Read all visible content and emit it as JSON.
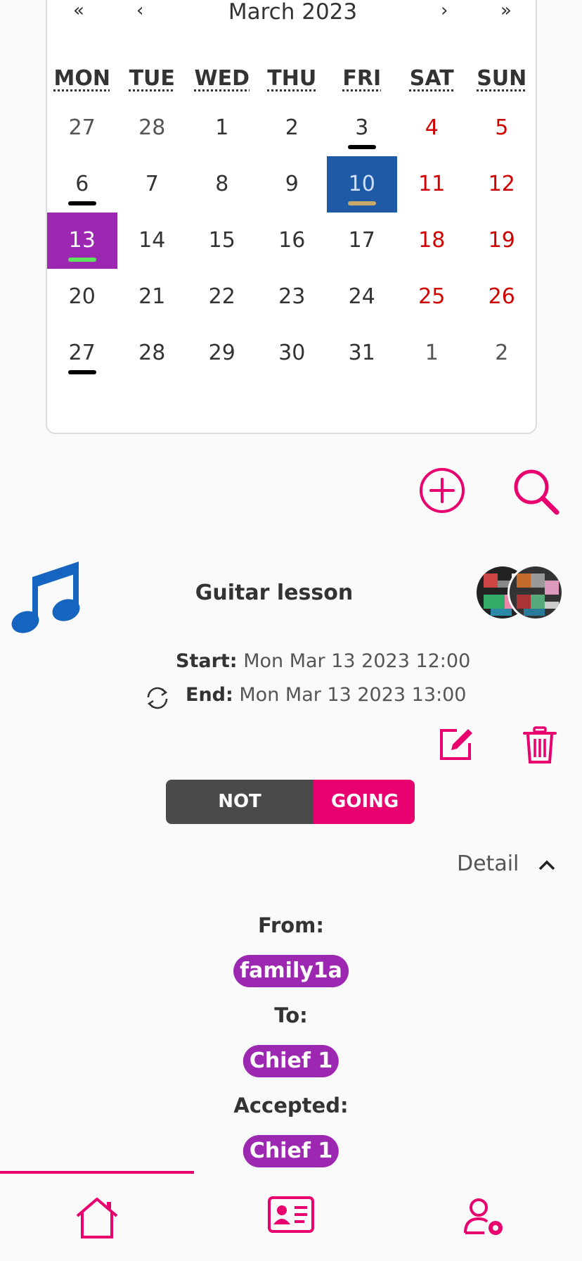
{
  "calendar": {
    "title": "March 2023",
    "nav": {
      "first": "«",
      "prev": "‹",
      "next": "›",
      "last": "»"
    },
    "weekdays": [
      "MON",
      "TUE",
      "WED",
      "THU",
      "FRI",
      "SAT",
      "SUN"
    ],
    "weeks": [
      [
        "27",
        "28",
        "1",
        "2",
        "3",
        "4",
        "5"
      ],
      [
        "6",
        "7",
        "8",
        "9",
        "10",
        "11",
        "12"
      ],
      [
        "13",
        "14",
        "15",
        "16",
        "17",
        "18",
        "19"
      ],
      [
        "20",
        "21",
        "22",
        "23",
        "24",
        "25",
        "26"
      ],
      [
        "27",
        "28",
        "29",
        "30",
        "31",
        "1",
        "2"
      ]
    ],
    "colors": {
      "weekend": "#d10000",
      "today_bg": "#1f5aa6",
      "selected_bg": "#9c27b0",
      "mark_default": "#000000",
      "mark_today": "#c8a96a",
      "mark_selected": "#5fe35f"
    }
  },
  "actions": {
    "add_icon": "plus-circle-icon",
    "search_icon": "search-icon"
  },
  "event": {
    "icon": "music-note-icon",
    "title": "Guitar lesson",
    "start_label": "Start:",
    "start_value": "Mon Mar 13 2023 12:00",
    "end_label": "End:",
    "end_value": "Mon Mar 13 2023 13:00",
    "repeat_icon": "repeat-icon",
    "edit_icon": "edit-icon",
    "delete_icon": "trash-icon"
  },
  "rsvp": {
    "not_going": "NOT GOING",
    "going": "GOING",
    "selected": "GOING"
  },
  "detail": {
    "toggle_label": "Detail",
    "from_label": "From:",
    "from_value": "family1a",
    "to_label": "To:",
    "to_value": "Chief 1",
    "accepted_label": "Accepted:",
    "accepted_value": "Chief 1"
  },
  "bottom_nav": {
    "items": [
      "home-icon",
      "contact-card-icon",
      "user-settings-icon"
    ],
    "active": "home-icon"
  },
  "colors": {
    "accent": "#e8006f",
    "chip": "#9c27b0",
    "music": "#1565c0"
  }
}
